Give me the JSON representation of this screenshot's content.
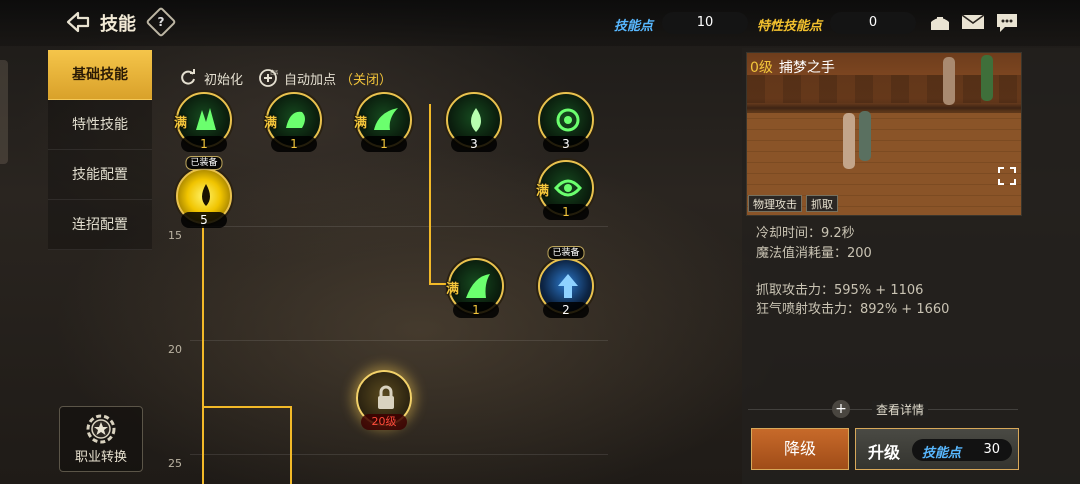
{
  "header": {
    "title": "技能",
    "help": "?",
    "skill_points_label": "技能点",
    "skill_points": "10",
    "trait_points_label": "特性技能点",
    "trait_points": "0"
  },
  "sidebar": {
    "tabs": [
      {
        "label": "基础技能",
        "active": true
      },
      {
        "label": "特性技能"
      },
      {
        "label": "技能配置"
      },
      {
        "label": "连招配置"
      }
    ],
    "job_change": "职业转换"
  },
  "actions": {
    "reset": "初始化",
    "auto_add": "自动加点",
    "auto_status": "（关闭）",
    "auto_icon_text": "自动"
  },
  "tree": {
    "level_markers": [
      "15",
      "20",
      "25"
    ],
    "max_mark": "满",
    "equipped": "已装备",
    "skills": [
      {
        "level": "1",
        "max": true
      },
      {
        "level": "1",
        "max": true
      },
      {
        "level": "1",
        "max": true
      },
      {
        "level": "3"
      },
      {
        "level": "3"
      },
      {
        "level": "5",
        "equipped": true
      },
      {
        "level": "1",
        "max": true
      },
      {
        "level": "1",
        "max": true
      },
      {
        "level": "2",
        "equipped": true
      },
      {
        "level": "20级",
        "locked": true
      }
    ]
  },
  "detail": {
    "level_prefix": "0级",
    "name": "捕梦之手",
    "tags": [
      "物理攻击",
      "抓取"
    ],
    "stats": [
      "冷却时间：9.2秒",
      "魔法值消耗量：200",
      "抓取攻击力：595% + 1106",
      "狂气喷射攻击力：892% + 1660"
    ],
    "view_details": "查看详情",
    "downgrade": "降级",
    "upgrade": "升级",
    "upgrade_points_label": "技能点",
    "upgrade_points": "30"
  },
  "colors": {
    "gold": "#f2b928",
    "blue_label": "#58b8ff",
    "yellow_label": "#f3c12e",
    "downgrade_bg": "#b45a20"
  }
}
